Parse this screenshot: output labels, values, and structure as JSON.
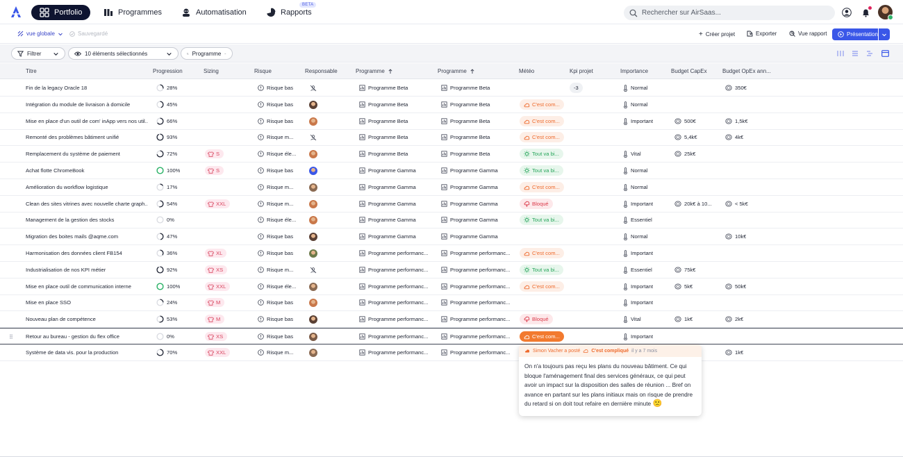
{
  "nav": {
    "tabs": [
      {
        "label": "Portfolio",
        "icon": "portfolio-icon",
        "active": true
      },
      {
        "label": "Programmes",
        "icon": "programmes-icon"
      },
      {
        "label": "Automatisation",
        "icon": "automation-icon"
      },
      {
        "label": "Rapports",
        "icon": "reports-icon"
      }
    ],
    "beta": "BETA",
    "search_placeholder": "Rechercher sur AirSaas..."
  },
  "toolbar": {
    "view": "vue globale",
    "saved": "Sauvegardé",
    "create": "Créer projet",
    "export": "Exporter",
    "report": "Vue rapport",
    "present": "Présentation"
  },
  "filters": {
    "filter": "Filtrer",
    "selection": "10 éléments sélectionnés",
    "group": "Programme"
  },
  "columns": [
    "Titre",
    "Progression",
    "Sizing",
    "Risque",
    "Responsable",
    "Programme",
    "Programme",
    "Météo",
    "Kpi projet",
    "Importance",
    "Budget CapEx",
    "Budget OpEx ann..."
  ],
  "rows": [
    {
      "title": "Fin de la legacy Oracle 18",
      "progress": "28%",
      "p": 0.28,
      "sizing": "",
      "risk": "Risque bas",
      "resp": "none",
      "prog1": "Programme Beta",
      "prog2": "Programme Beta",
      "meteo": "",
      "meteo_c": "",
      "kpi": "-3",
      "imp": "Normal",
      "capex": "",
      "opex": "350€"
    },
    {
      "title": "Intégration du module de livraison à domicile",
      "progress": "45%",
      "p": 0.45,
      "sizing": "",
      "risk": "Risque bas",
      "resp": "a1",
      "prog1": "Programme Beta",
      "prog2": "Programme Beta",
      "meteo": "C'est com...",
      "meteo_c": "orange",
      "kpi": "",
      "imp": "Normal",
      "capex": "",
      "opex": ""
    },
    {
      "title": "Mise en place d'un outil de com' inApp vers nos util...",
      "progress": "66%",
      "p": 0.66,
      "sizing": "",
      "risk": "Risque bas",
      "resp": "a2",
      "prog1": "Programme Beta",
      "prog2": "Programme Beta",
      "meteo": "C'est com...",
      "meteo_c": "orange",
      "kpi": "",
      "imp": "Important",
      "capex": "500€",
      "opex": "1,5k€"
    },
    {
      "title": "Remonté des problèmes bâtiment unifié",
      "progress": "93%",
      "p": 0.93,
      "sizing": "",
      "risk": "Risque m...",
      "resp": "none",
      "prog1": "Programme Beta",
      "prog2": "Programme Beta",
      "meteo": "C'est com...",
      "meteo_c": "orange",
      "kpi": "",
      "imp": "",
      "capex": "5,4k€",
      "opex": "4k€"
    },
    {
      "title": "Remplacement du système de paiement",
      "progress": "72%",
      "p": 0.72,
      "sizing": "S",
      "risk": "Risque éle...",
      "resp": "a2",
      "prog1": "Programme Beta",
      "prog2": "Programme Beta",
      "meteo": "Tout va bi...",
      "meteo_c": "green",
      "kpi": "",
      "imp": "Vital",
      "capex": "25k€",
      "opex": ""
    },
    {
      "title": "Achat flotte ChromeBook",
      "progress": "100%",
      "p": 1.0,
      "sizing": "S",
      "risk": "Risque bas",
      "resp": "a3",
      "prog1": "Programme Gamma",
      "prog2": "Programme Gamma",
      "meteo": "Tout va bi...",
      "meteo_c": "green",
      "kpi": "",
      "imp": "Normal",
      "capex": "",
      "opex": ""
    },
    {
      "title": "Amélioration du workflow logistique",
      "progress": "17%",
      "p": 0.17,
      "sizing": "",
      "risk": "Risque m...",
      "resp": "a4",
      "prog1": "Programme Gamma",
      "prog2": "Programme Gamma",
      "meteo": "C'est com...",
      "meteo_c": "orange",
      "kpi": "",
      "imp": "Normal",
      "capex": "",
      "opex": ""
    },
    {
      "title": "Clean des sites vitrines avec nouvelle charte graph...",
      "progress": "54%",
      "p": 0.54,
      "sizing": "XXL",
      "risk": "Risque m...",
      "resp": "a2",
      "prog1": "Programme Gamma",
      "prog2": "Programme Gamma",
      "meteo": "Bloqué",
      "meteo_c": "red",
      "kpi": "",
      "imp": "Important",
      "capex": "20k€ à 10...",
      "opex": "< 5k€"
    },
    {
      "title": "Management de la gestion des stocks",
      "progress": "0%",
      "p": 0.0,
      "sizing": "",
      "risk": "Risque éle...",
      "resp": "a2",
      "prog1": "Programme Gamma",
      "prog2": "Programme Gamma",
      "meteo": "Tout va bi...",
      "meteo_c": "green",
      "kpi": "",
      "imp": "Essentiel",
      "capex": "",
      "opex": ""
    },
    {
      "title": "Migration des boites mails @aqme.com",
      "progress": "47%",
      "p": 0.47,
      "sizing": "",
      "risk": "Risque bas",
      "resp": "a1",
      "prog1": "Programme Gamma",
      "prog2": "Programme Gamma",
      "meteo": "",
      "meteo_c": "",
      "kpi": "",
      "imp": "Normal",
      "capex": "",
      "opex": "10k€"
    },
    {
      "title": "Harmonisation des données client FB154",
      "progress": "36%",
      "p": 0.36,
      "sizing": "XL",
      "risk": "Risque bas",
      "resp": "a5",
      "prog1": "Programme performanc...",
      "prog2": "Programme performanc...",
      "meteo": "C'est com...",
      "meteo_c": "orange",
      "kpi": "",
      "imp": "Important",
      "capex": "",
      "opex": ""
    },
    {
      "title": "Industrialisation de nos KPI métier",
      "progress": "92%",
      "p": 0.92,
      "sizing": "XS",
      "risk": "Risque m...",
      "resp": "none",
      "prog1": "Programme performanc...",
      "prog2": "Programme performanc...",
      "meteo": "Tout va bi...",
      "meteo_c": "green",
      "kpi": "",
      "imp": "Essentiel",
      "capex": "75k€",
      "opex": ""
    },
    {
      "title": "Mise en place outil de communication interne",
      "progress": "100%",
      "p": 1.0,
      "sizing": "XXL",
      "risk": "Risque éle...",
      "resp": "a4",
      "prog1": "Programme performanc...",
      "prog2": "Programme performanc...",
      "meteo": "C'est com...",
      "meteo_c": "orange",
      "kpi": "",
      "imp": "Important",
      "capex": "5k€",
      "opex": "50k€"
    },
    {
      "title": "Mise en place SSO",
      "progress": "24%",
      "p": 0.24,
      "sizing": "M",
      "risk": "Risque bas",
      "resp": "a2",
      "prog1": "Programme performanc...",
      "prog2": "Programme performanc...",
      "meteo": "",
      "meteo_c": "",
      "kpi": "",
      "imp": "Important",
      "capex": "",
      "opex": ""
    },
    {
      "title": "Nouveau plan de compétence",
      "progress": "53%",
      "p": 0.53,
      "sizing": "M",
      "risk": "Risque bas",
      "resp": "a1",
      "prog1": "Programme performanc...",
      "prog2": "Programme performanc...",
      "meteo": "Bloqué",
      "meteo_c": "red",
      "kpi": "",
      "imp": "Vital",
      "capex": "1k€",
      "opex": "2k€"
    },
    {
      "title": "Retour au bureau - gestion du flex office",
      "progress": "0%",
      "p": 0.0,
      "sizing": "XS",
      "risk": "Risque bas",
      "resp": "a6",
      "prog1": "Programme performanc...",
      "prog2": "Programme performanc...",
      "meteo": "C'est com...",
      "meteo_c": "strong",
      "kpi": "",
      "imp": "Important",
      "capex": "",
      "opex": ""
    },
    {
      "title": "Système de data vis. pour la production",
      "progress": "70%",
      "p": 0.7,
      "sizing": "XXL",
      "risk": "Risque m...",
      "resp": "a4",
      "prog1": "Programme performanc...",
      "prog2": "Programme performanc...",
      "meteo": "",
      "meteo_c": "",
      "kpi": "",
      "imp": "",
      "capex": "",
      "opex": "1k€"
    }
  ],
  "popup": {
    "author": "Simon Vacher a posté",
    "status": "C'est compliqué",
    "time": "il y a 7 mois",
    "body": "On n'a toujours pas reçu les plans du nouveau bâtiment. Ce qui bloque l'aménagement final des services généraux, ce qui peut avoir un impact sur la disposition des salles de réunion ... Bref on avance en partant sur les plans initiaux mais on risque de prendre du retard si on doit tout refaire en dernière minute",
    "emoji": "🙁"
  },
  "colors": {
    "accent": "#3a57e8",
    "nav_active": "#0e1430",
    "orange": "#ee6a2c",
    "green": "#26a55a",
    "red": "#db3b4b",
    "sizing": "#d8455f"
  }
}
